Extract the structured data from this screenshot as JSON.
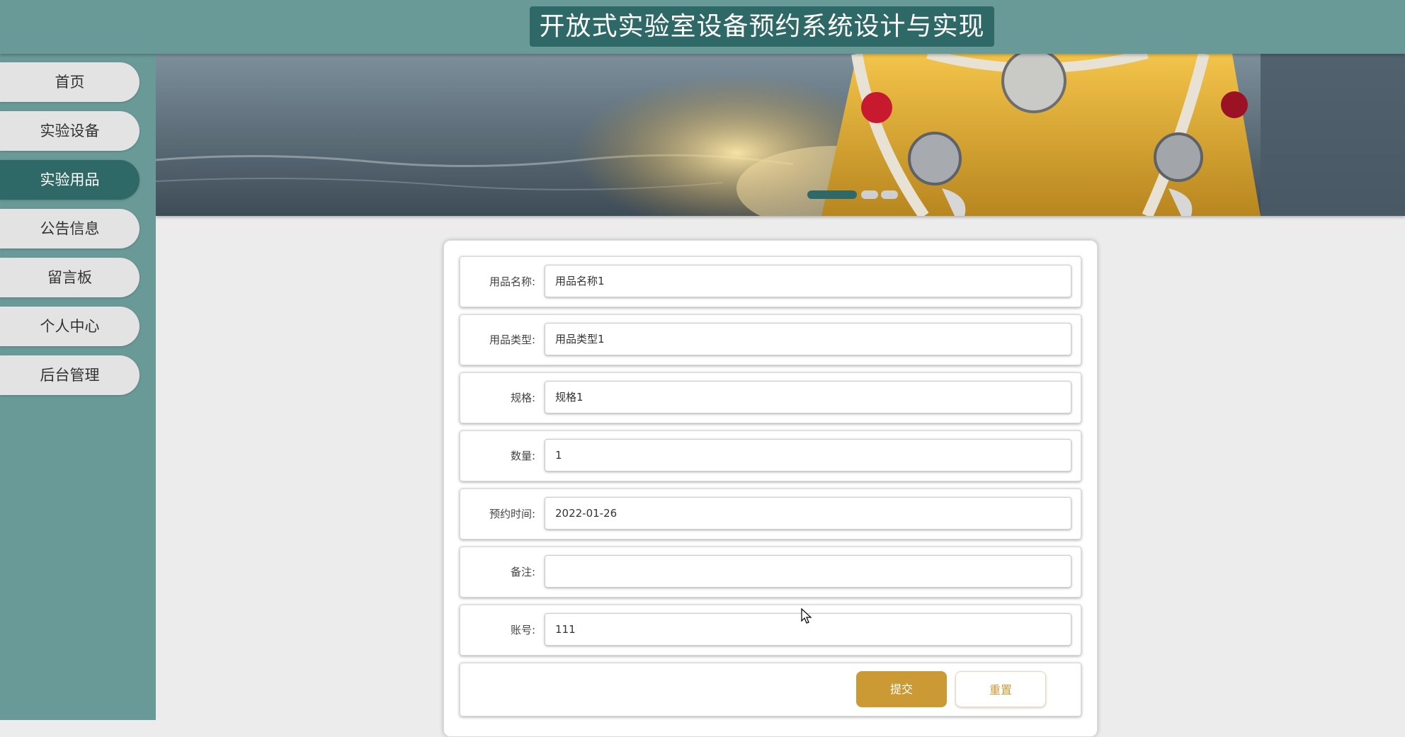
{
  "header": {
    "title": "开放式实验室设备预约系统设计与实现"
  },
  "sidebar": {
    "items": [
      {
        "label": "首页",
        "active": false
      },
      {
        "label": "实验设备",
        "active": false
      },
      {
        "label": "实验用品",
        "active": true
      },
      {
        "label": "公告信息",
        "active": false
      },
      {
        "label": "留言板",
        "active": false
      },
      {
        "label": "个人中心",
        "active": false
      },
      {
        "label": "后台管理",
        "active": false
      }
    ]
  },
  "banner": {
    "indicator_count": 3,
    "active_index": 0
  },
  "form": {
    "fields": [
      {
        "label": "用品名称:",
        "value": "用品名称1"
      },
      {
        "label": "用品类型:",
        "value": "用品类型1"
      },
      {
        "label": "规格:",
        "value": "规格1"
      },
      {
        "label": "数量:",
        "value": "1"
      },
      {
        "label": "预约时间:",
        "value": "2022-01-26"
      },
      {
        "label": "备注:",
        "value": ""
      },
      {
        "label": "账号:",
        "value": "111"
      }
    ],
    "submit_label": "提交",
    "reset_label": "重置"
  },
  "colors": {
    "header_bg": "#6a9a98",
    "accent_dark": "#2e6967",
    "button_gold": "#cc9a35",
    "page_bg": "#ececec"
  }
}
